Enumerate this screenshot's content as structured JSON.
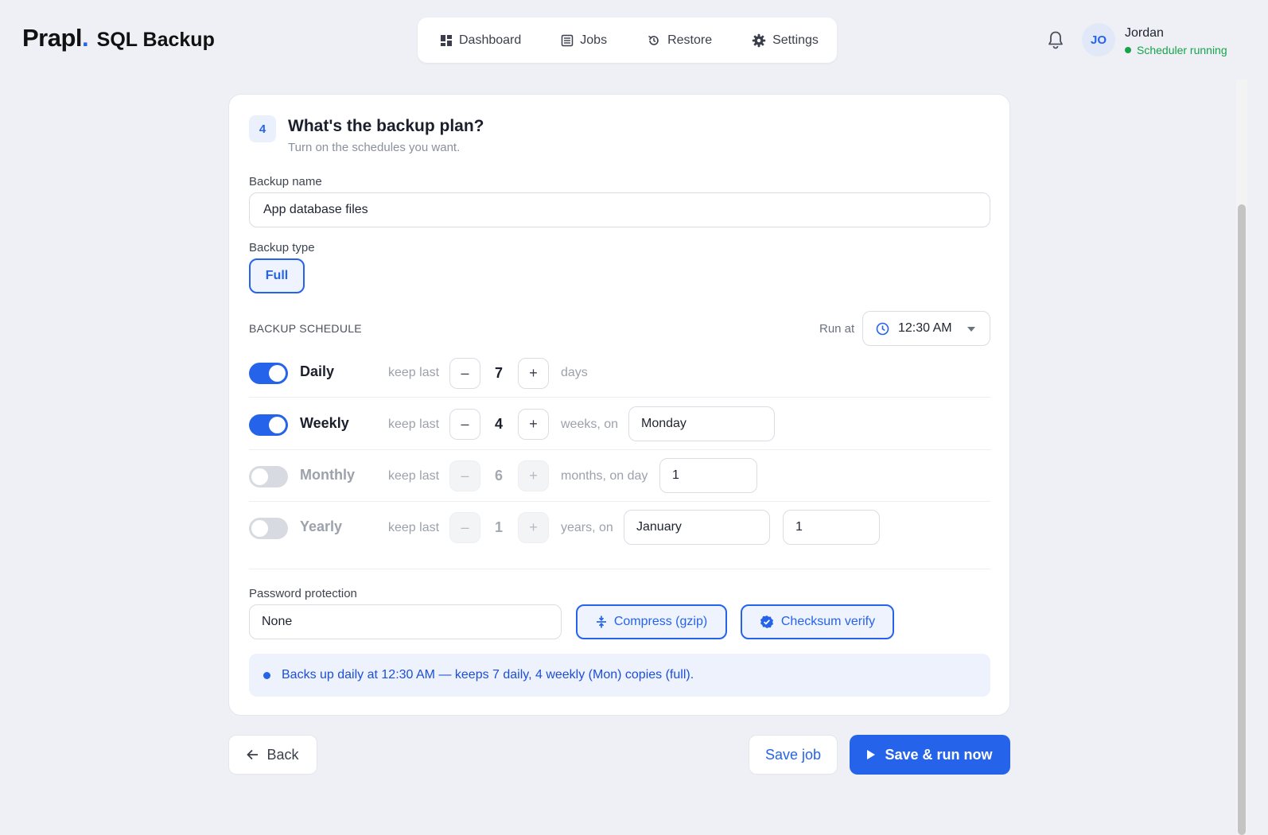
{
  "app": {
    "brand": "Prapl",
    "brand_dot": ".",
    "product": "SQL Backup"
  },
  "nav": {
    "items": [
      {
        "label": "Dashboard",
        "icon": "dashboard-icon"
      },
      {
        "label": "Jobs",
        "icon": "list-icon"
      },
      {
        "label": "Restore",
        "icon": "restore-icon"
      },
      {
        "label": "Settings",
        "icon": "gear-icon"
      }
    ]
  },
  "user": {
    "initials": "JO",
    "name": "Jordan",
    "status": "Scheduler running"
  },
  "step": {
    "number": "4",
    "title": "What's the backup plan?",
    "subtitle": "Turn on the schedules you want."
  },
  "form": {
    "backup_name_label": "Backup name",
    "backup_name_value": "App database files",
    "backup_type_label": "Backup type",
    "backup_type_option": "Full",
    "schedule_heading": "BACKUP SCHEDULE",
    "run_at_label": "Run at",
    "run_at_value": "12:30 AM"
  },
  "schedules": [
    {
      "name": "Daily",
      "enabled": true,
      "keep_label": "keep last",
      "count": "7",
      "unit": "days"
    },
    {
      "name": "Weekly",
      "enabled": true,
      "keep_label": "keep last",
      "count": "4",
      "unit": "weeks, on",
      "day": "Monday"
    },
    {
      "name": "Monthly",
      "enabled": false,
      "keep_label": "keep last",
      "count": "6",
      "unit": "months, on day",
      "day": "1"
    },
    {
      "name": "Yearly",
      "enabled": false,
      "keep_label": "keep last",
      "count": "1",
      "unit": "years, on",
      "month": "January",
      "day": "1"
    }
  ],
  "stepper": {
    "minus": "–",
    "plus": "+"
  },
  "options": {
    "password_label": "Password protection",
    "password_value": "None",
    "compress_label": "Compress (gzip)",
    "checksum_label": "Checksum verify"
  },
  "summary": "Backs up daily at 12:30 AM — keeps 7 daily, 4 weekly (Mon) copies (full).",
  "footer": {
    "back": "Back",
    "save": "Save job",
    "run": "Save & run now"
  },
  "colors": {
    "accent": "#2563eb",
    "status_ok": "#16a34a",
    "background": "#eef0f5"
  }
}
